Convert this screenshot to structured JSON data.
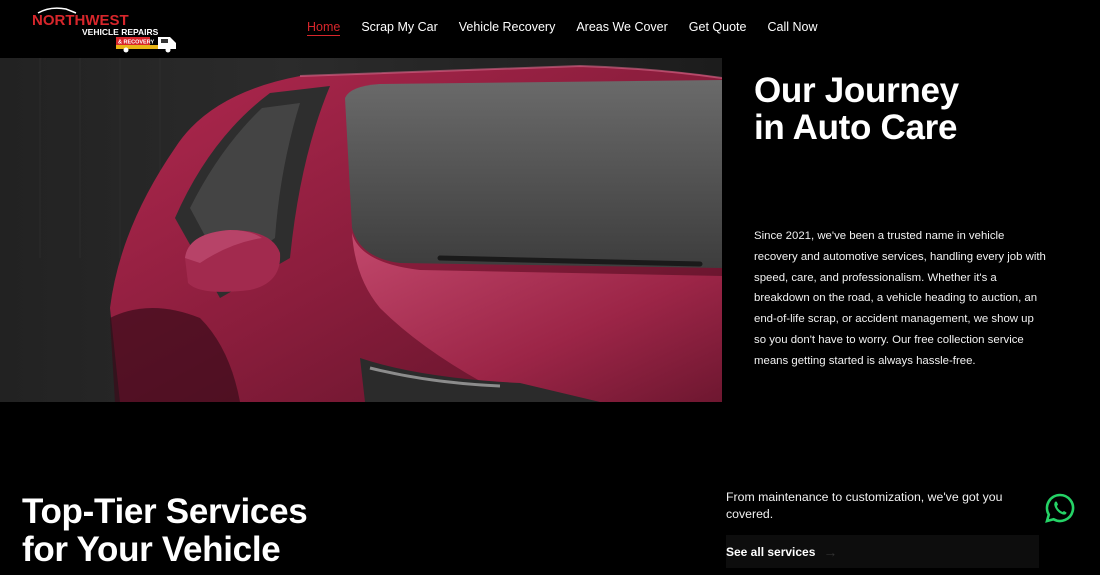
{
  "brand": {
    "name_line1": "NORTHWEST",
    "name_line2": "VEHICLE REPAIRS",
    "name_line3": "& RECOVERY"
  },
  "nav": {
    "items": [
      "Home",
      "Scrap My Car",
      "Vehicle Recovery",
      "Areas We Cover",
      "Get Quote",
      "Call Now"
    ],
    "active_index": 0
  },
  "hero": {
    "title_line1": "Our Journey",
    "title_line2": "in Auto Care",
    "body": "Since 2021, we've been a trusted name in vehicle recovery and automotive services, handling every job with speed, care, and professionalism. Whether it's a breakdown on the road, a vehicle heading to auction, an end-of-life scrap, or accident management, we show up so you don't have to worry. Our free collection service means getting started is always hassle-free."
  },
  "services": {
    "title_line1": "Top-Tier Services",
    "title_line2": "for Your Vehicle",
    "subtitle": "From maintenance to customization, we've got you covered.",
    "cta_label": "See all services"
  },
  "colors": {
    "accent": "#d7262b",
    "background": "#000000",
    "car": "#8e1d3e",
    "whatsapp": "#25d366"
  },
  "icons": {
    "whatsapp": "whatsapp-icon",
    "arrow": "arrow-right-icon"
  }
}
